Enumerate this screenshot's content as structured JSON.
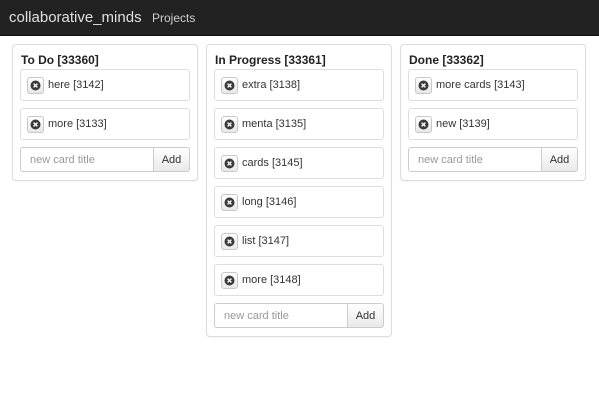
{
  "navbar": {
    "brand": "collaborative_minds",
    "projects_link": "Projects"
  },
  "columns": [
    {
      "title": "To Do [33360]",
      "cards": [
        "here [3142]",
        "more [3133]"
      ],
      "input_placeholder": "new card title",
      "add_label": "Add"
    },
    {
      "title": "In Progress [33361]",
      "cards": [
        "extra [3138]",
        "menta [3135]",
        "cards [3145]",
        "long [3146]",
        "list [3147]",
        "more [3148]"
      ],
      "input_placeholder": "new card title",
      "add_label": "Add"
    },
    {
      "title": "Done [33362]",
      "cards": [
        "more cards [3143]",
        "new [3139]"
      ],
      "input_placeholder": "new card title",
      "add_label": "Add"
    }
  ],
  "icons": {
    "card_button": "circle-x-icon"
  }
}
